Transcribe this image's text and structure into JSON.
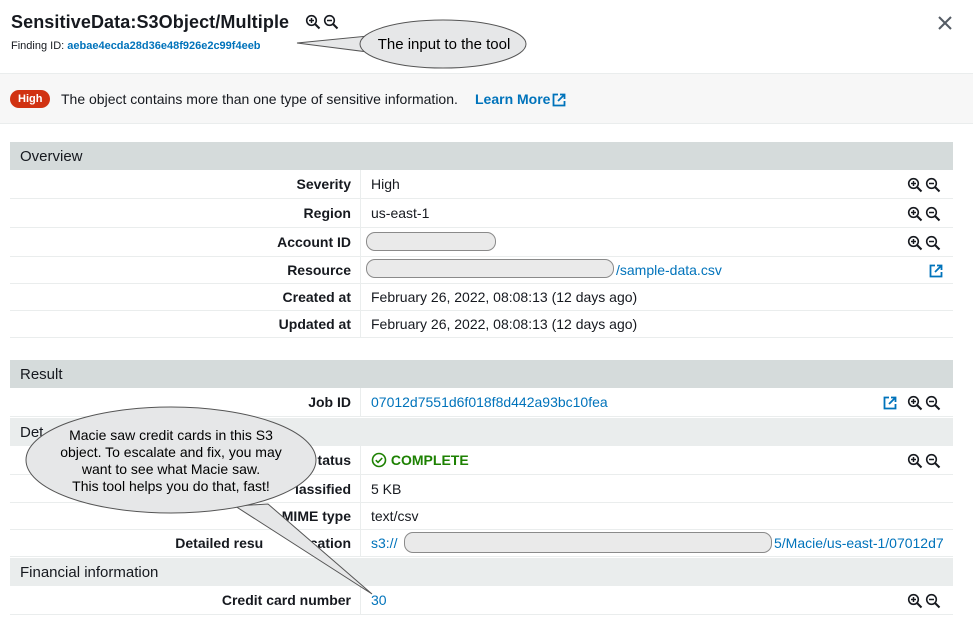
{
  "header": {
    "title": "SensitiveData:S3Object/Multiple",
    "finding_label": "Finding ID:",
    "finding_id": "aebae4ecda28d36e48f926e2c99f4eeb"
  },
  "banner": {
    "severity": "High",
    "text": "The object contains more than one type of sensitive information.",
    "learn_more": "Learn More"
  },
  "overview": {
    "heading": "Overview",
    "rows": [
      {
        "label": "Severity",
        "value": "High"
      },
      {
        "label": "Region",
        "value": "us-east-1"
      },
      {
        "label": "Account ID",
        "value": ""
      },
      {
        "label": "Resource",
        "value": "/sample-data.csv"
      },
      {
        "label": "Created at",
        "value": "February 26, 2022, 08:08:13 (12 days ago)"
      },
      {
        "label": "Updated at",
        "value": "February 26, 2022, 08:08:13 (12 days ago)"
      }
    ]
  },
  "result": {
    "heading": "Result",
    "job_label": "Job ID",
    "job_id": "07012d7551d6f018f8d442a93bc10fea",
    "details_heading": "Det",
    "status_label": "tatus",
    "status_value": "COMPLETE",
    "classified_label": "lassified",
    "classified_value": "5 KB",
    "mime_label": "MIME type",
    "mime_value": "text/csv",
    "detailed_label_a": "Detailed resu",
    "detailed_label_b": "ocation",
    "detailed_prefix": "s3://",
    "detailed_suffix": "5/Macie/us-east-1/07012d7"
  },
  "financial": {
    "heading": "Financial information",
    "cc_label": "Credit card number",
    "cc_value": "30"
  },
  "callouts": {
    "tool_input": "The input to the tool",
    "macie_line1": "Macie saw credit cards in this S3",
    "macie_line2": "object. To escalate and fix, you may",
    "macie_line3": "want to see what Macie saw.",
    "macie_line4": "This tool helps you do that, fast!"
  },
  "colors": {
    "link": "#0073bb",
    "severity_high": "#d13212",
    "complete": "#1d8102",
    "section_bg": "#d5dbdb"
  }
}
